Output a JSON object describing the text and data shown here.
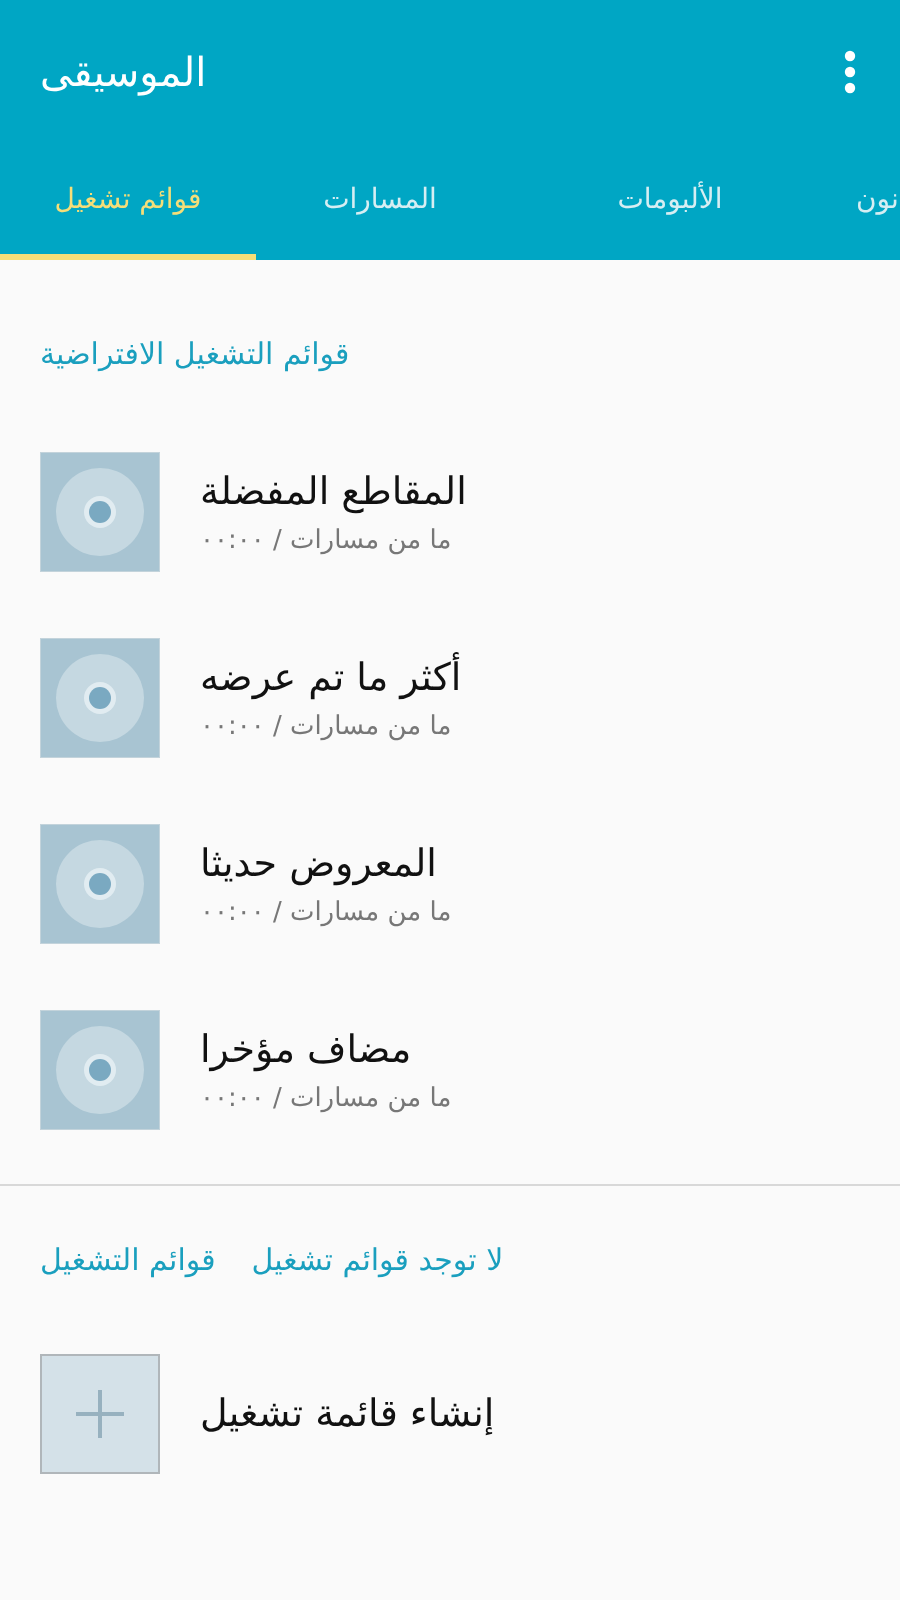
{
  "app_bar": {
    "title": "الموسيقى"
  },
  "tabs": [
    {
      "label": "نون",
      "selected": false
    },
    {
      "label": "الألبومات",
      "selected": false
    },
    {
      "label": "المسارات",
      "selected": false
    },
    {
      "label": "قوائم تشغيل",
      "selected": true
    }
  ],
  "default_playlists": {
    "header": "قوائم التشغيل الافتراضية",
    "items": [
      {
        "title": "المقاطع المفضلة",
        "subtitle": "ما من مسارات / ٠٠:٠٠"
      },
      {
        "title": "أكثر ما تم عرضه",
        "subtitle": "ما من مسارات / ٠٠:٠٠"
      },
      {
        "title": "المعروض حديثا",
        "subtitle": "ما من مسارات / ٠٠:٠٠"
      },
      {
        "title": "مضاف مؤخرا",
        "subtitle": "ما من مسارات / ٠٠:٠٠"
      }
    ]
  },
  "playlists": {
    "header": "قوائم التشغيل",
    "empty_message": "لا توجد قوائم تشغيل",
    "create_label": "إنشاء قائمة تشغيل"
  }
}
